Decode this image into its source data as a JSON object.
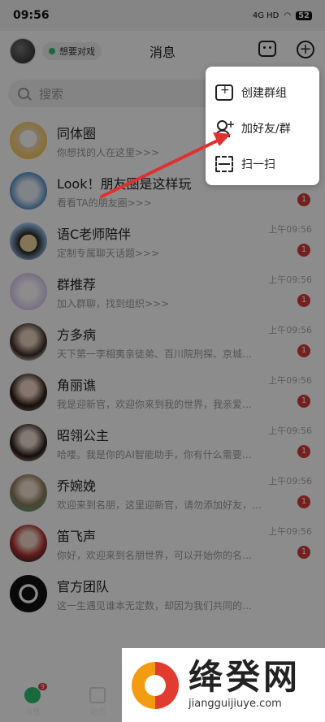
{
  "statusbar": {
    "time": "09:56",
    "network": "4G HD",
    "battery": "52"
  },
  "header": {
    "status_label": "想要对戏",
    "title": "消息"
  },
  "search": {
    "placeholder": "搜索"
  },
  "conversations": [
    {
      "name": "同体圈",
      "preview": "你想找的人在这里>>>",
      "time": "",
      "badge": ""
    },
    {
      "name": "Look！朋友圈是这样玩",
      "preview": "看看TA的朋友圈>>>",
      "time": "",
      "badge": "1"
    },
    {
      "name": "语C老师陪伴",
      "preview": "定制专属聊天话题>>>",
      "time": "上午09:56",
      "badge": "1"
    },
    {
      "name": "群推荐",
      "preview": "加入群聊，找到组织>>>",
      "time": "上午09:56",
      "badge": "1"
    },
    {
      "name": "方多病",
      "preview": "天下第一李相夷亲徒弟、百川院刑探、京城…",
      "time": "上午09:56",
      "badge": "1"
    },
    {
      "name": "角丽谯",
      "preview": "我是迎新官，欢迎你来到我的世界，我亲爱…",
      "time": "上午09:56",
      "badge": "1"
    },
    {
      "name": "昭翎公主",
      "preview": "哈喽。我是你的AI智能助手，你有什么需要…",
      "time": "上午09:56",
      "badge": "1"
    },
    {
      "name": "乔婉娩",
      "preview": "欢迎来到名朋，这里迎新官，请勿添加好友，…",
      "time": "上午09:56",
      "badge": "1"
    },
    {
      "name": "笛飞声",
      "preview": "你好，欢迎来到名朋世界，可以开始你的名…",
      "time": "上午09:56",
      "badge": "1"
    },
    {
      "name": "官方团队",
      "preview": "这一生遇见谁本无定数，却因为我们共同的…",
      "time": "",
      "badge": ""
    }
  ],
  "menu": {
    "items": [
      {
        "label": "创建群组",
        "icon": "create-group-icon"
      },
      {
        "label": "加好友/群",
        "icon": "add-friend-icon"
      },
      {
        "label": "扫一扫",
        "icon": "scan-icon"
      }
    ]
  },
  "tabbar": {
    "tabs": [
      {
        "label": "消息",
        "badge": "9"
      },
      {
        "label": "动态"
      }
    ]
  },
  "watermark": {
    "brand": "绛癸网",
    "url": "jiangguijiuye.com"
  },
  "colors": {
    "accent_green": "#2fbf71",
    "badge_red": "#d83a3a",
    "arrow_red": "#e03030"
  }
}
